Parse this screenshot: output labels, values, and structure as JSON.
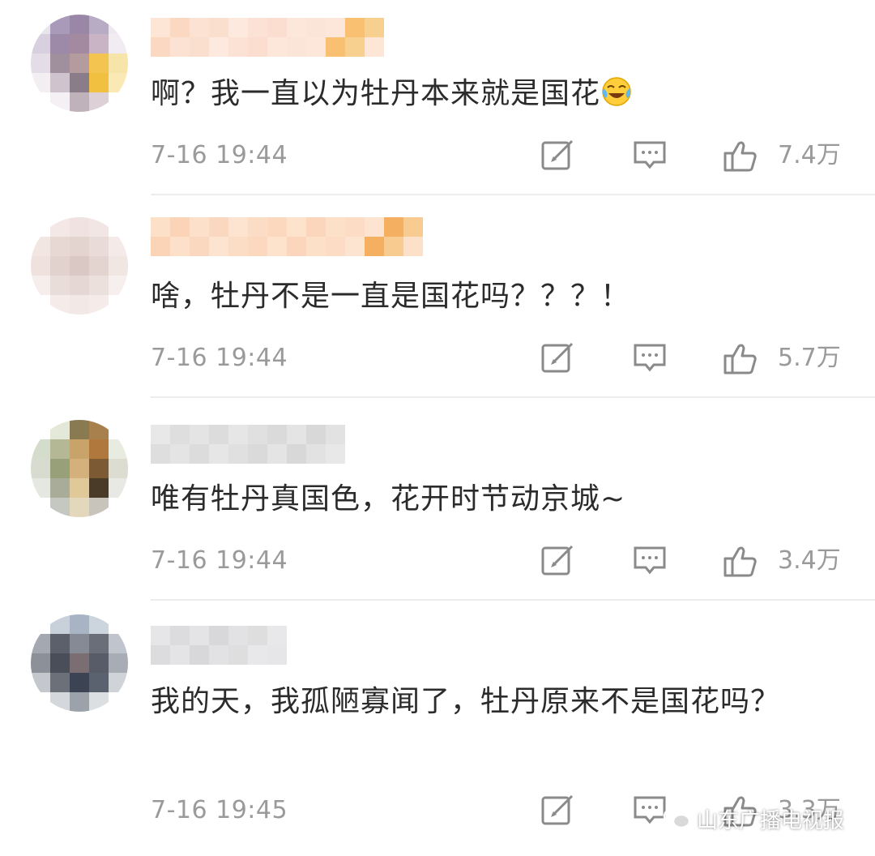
{
  "comments": [
    {
      "text": "啊？我一直以为牡丹本来就是国花",
      "emoji": "laughing-crying-emoji",
      "time": "7-16 19:44",
      "likes": "7.4万",
      "avatar_colors": [
        "#e8e4ec",
        "#a89ab8",
        "#9a86a6",
        "#b8acc4",
        "#ede8f0",
        "#d8d0de",
        "#9d8aa8",
        "#a48aa0",
        "#c8b4c4",
        "#f0ecf2",
        "#e4dce6",
        "#a0909e",
        "#b49c9e",
        "#f4c450",
        "#f6e4a8",
        "#f2eef2",
        "#cfc3cd",
        "#8a7c88",
        "#f2c040",
        "#fbe9b5",
        "#ffffff",
        "#f4f0f4",
        "#bfb2bb",
        "#ddd0d6",
        "#ffffff"
      ],
      "name_colors": [
        "#fde6d6",
        "#fbd8c2",
        "#fce2d2",
        "#fadfce",
        "#fde9dd",
        "#fce2d4",
        "#fcded0",
        "#fde7db",
        "#fbe4d8",
        "#fde6da",
        "#f8c070",
        "#f7d090"
      ]
    },
    {
      "text": "啥，牡丹不是一直是国花吗？？？！",
      "time": "7-16 19:44",
      "likes": "5.7万",
      "avatar_colors": [
        "#ffffff",
        "#f3e8e6",
        "#efe2e0",
        "#f1e6e4",
        "#ffffff",
        "#f2e6e2",
        "#e7d8d4",
        "#e3d4d0",
        "#e9dcd8",
        "#f4ebe9",
        "#efe2de",
        "#e1d2ce",
        "#d9c8c4",
        "#e3d4d0",
        "#f0e6e2",
        "#f6eeec",
        "#e9ddd9",
        "#e5d8d4",
        "#ebe0dc",
        "#f6efed",
        "#ffffff",
        "#f5ecea",
        "#f2e8e6",
        "#f5ecea",
        "#ffffff"
      ],
      "name_colors": [
        "#fde0c8",
        "#fbd4b8",
        "#fce0ca",
        "#fad8c0",
        "#fde4d0",
        "#fbdcc4",
        "#fcd8be",
        "#fde2cc",
        "#fbd6bc",
        "#fde0c8",
        "#fcdcc4",
        "#fde4d0",
        "#f4b060",
        "#f8cc90"
      ]
    },
    {
      "text": "唯有牡丹真国色，花开时节动京城~",
      "time": "7-16 19:44",
      "likes": "3.4万",
      "avatar_colors": [
        "#ffffff",
        "#e4e8d8",
        "#8a7a52",
        "#a8804e",
        "#ffffff",
        "#d4dccc",
        "#b4b894",
        "#c8a46a",
        "#b0783c",
        "#e8ece0",
        "#d8dcd0",
        "#98a07a",
        "#d4b07c",
        "#7c5a34",
        "#dcdcd0",
        "#e4e8e0",
        "#a8ac98",
        "#e0c898",
        "#4a3a28",
        "#e8e8e4",
        "#ffffff",
        "#c4c8c0",
        "#e4d8bc",
        "#c8c4bc",
        "#ffffff"
      ],
      "name_colors": [
        "#e8e8e8",
        "#dedede",
        "#e4e4e4",
        "#dcdcdc",
        "#e6e6e6",
        "#e0e0e0",
        "#dadada",
        "#e4e4e4",
        "#d8d8d8",
        "#e2e2e2"
      ]
    },
    {
      "text": "我的天，我孤陋寡闻了，牡丹原来不是国花吗？",
      "time": "7-16 19:45",
      "likes": "3.3万",
      "avatar_colors": [
        "#ffffff",
        "#c8d0da",
        "#a8b4c4",
        "#ccd4de",
        "#ffffff",
        "#a4a8b0",
        "#5c606a",
        "#868a94",
        "#6a6e78",
        "#c0c4cc",
        "#8c9098",
        "#4a4e58",
        "#7a6e72",
        "#585c68",
        "#a8acb4",
        "#c4c8cc",
        "#6c7078",
        "#3c4454",
        "#5a6270",
        "#d0d4d8",
        "#ffffff",
        "#d4d8dc",
        "#9ca2aa",
        "#dcdfe2",
        "#ffffff"
      ],
      "name_colors": [
        "#e6e6e8",
        "#dcdcde",
        "#e4e4e6",
        "#d8d8da",
        "#e2e2e4",
        "#dededf",
        "#e8e8ea"
      ]
    }
  ],
  "watermark": {
    "text": "山东广播电视报",
    "icon": "wechat-icon"
  }
}
